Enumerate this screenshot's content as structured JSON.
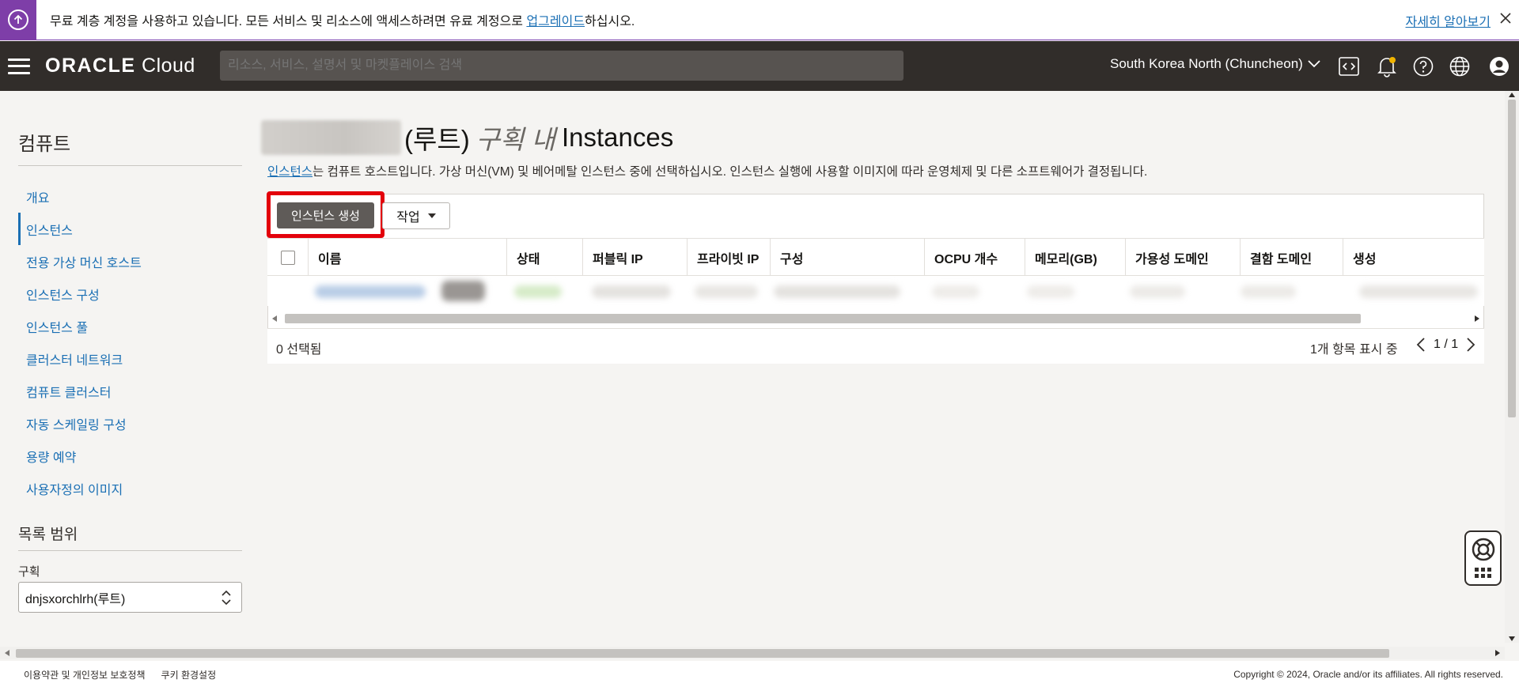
{
  "banner": {
    "message_prefix": "무료 계층 계정을 사용하고 있습니다. 모든 서비스 및 리소스에 액세스하려면 유료 계정으로 ",
    "upgrade_link": "업그레이드",
    "message_suffix": "하십시오.",
    "learn_more": "자세히 알아보기"
  },
  "header": {
    "logo_oracle": "ORACLE",
    "logo_cloud": "Cloud",
    "search_placeholder": "리소스, 서비스, 설명서 및 마켓플레이스 검색",
    "region": "South Korea North (Chuncheon)"
  },
  "sidebar": {
    "title": "컴퓨트",
    "items": [
      {
        "label": "개요"
      },
      {
        "label": "인스턴스"
      },
      {
        "label": "전용 가상 머신 호스트"
      },
      {
        "label": "인스턴스 구성"
      },
      {
        "label": "인스턴스 풀"
      },
      {
        "label": "클러스터 네트워크"
      },
      {
        "label": "컴퓨트 클러스터"
      },
      {
        "label": "자동 스케일링 구성"
      },
      {
        "label": "용량 예약"
      },
      {
        "label": "사용자정의 이미지"
      }
    ],
    "scope_title": "목록 범위",
    "compartment_label": "구획",
    "compartment_value": "dnjsxorchlrh(루트)"
  },
  "main": {
    "title_root": "(루트)",
    "title_in": "구획 내",
    "title_resource": "Instances",
    "desc_link": "인스턴스",
    "desc_text": "는 컴퓨트 호스트입니다. 가상 머신(VM) 및 베어메탈 인스턴스 중에 선택하십시오. 인스턴스 실행에 사용할 이미지에 따라 운영체제 및 다른 소프트웨어가 결정됩니다.",
    "create_button": "인스턴스 생성",
    "actions_button": "작업",
    "columns": [
      "이름",
      "상태",
      "퍼블릭 IP",
      "프라이빗 IP",
      "구성",
      "OCPU 개수",
      "메모리(GB)",
      "가용성 도메인",
      "결함 도메인",
      "생성"
    ],
    "selected_count": "0 선택됨",
    "items_shown": "1개 항목 표시 중",
    "page": "1 / 1"
  },
  "footer": {
    "terms": "이용약관 및 개인정보 보호정책",
    "cookies": "쿠키 환경설정",
    "copyright": "Copyright © 2024, Oracle and/or its affiliates. All rights reserved."
  },
  "colors": {
    "banner_accent": "#7e3ea8",
    "nav_bg": "#312d2a",
    "link": "#1a6fb4",
    "highlight": "#e3000b"
  }
}
